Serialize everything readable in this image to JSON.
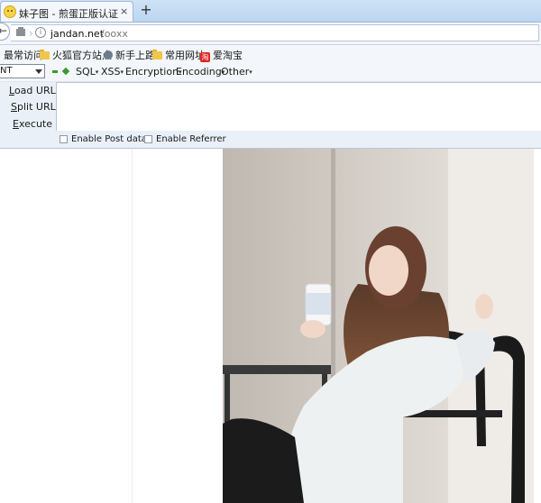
{
  "tab": {
    "title": "妹子图 - 煎蛋正版认证",
    "close": "×",
    "new_tab": "+"
  },
  "navbar": {
    "url_host": "jandan.net",
    "url_path": "/ooxx",
    "info": "i"
  },
  "bookmarks": [
    {
      "label": "最常访问",
      "icon": "none"
    },
    {
      "label": "火狐官方站点",
      "icon": "folder-icon"
    },
    {
      "label": "新手上路",
      "icon": "globe-icon"
    },
    {
      "label": "常用网址",
      "icon": "folder-icon"
    },
    {
      "label": "爱淘宝",
      "icon": "taobao-icon",
      "icon_glyph": "淘"
    }
  ],
  "hackbar": {
    "select_value": "NT",
    "menus": [
      "SQL",
      "XSS",
      "Encryption",
      "Encoding",
      "Other"
    ],
    "load_url": {
      "underlined": "L",
      "rest": "oad URL"
    },
    "split_url": {
      "underlined": "S",
      "rest": "plit URL"
    },
    "execute": {
      "underlined": "E",
      "rest": "xecute"
    },
    "enable_post_data": "Enable Post data",
    "enable_referrer": "Enable Referrer"
  },
  "colors": {
    "tabstrip": "#cfe2f6",
    "hackbar_bg": "#e9f0f8",
    "plus_minus": "#3a9a2e",
    "taobao": "#e0261d"
  }
}
